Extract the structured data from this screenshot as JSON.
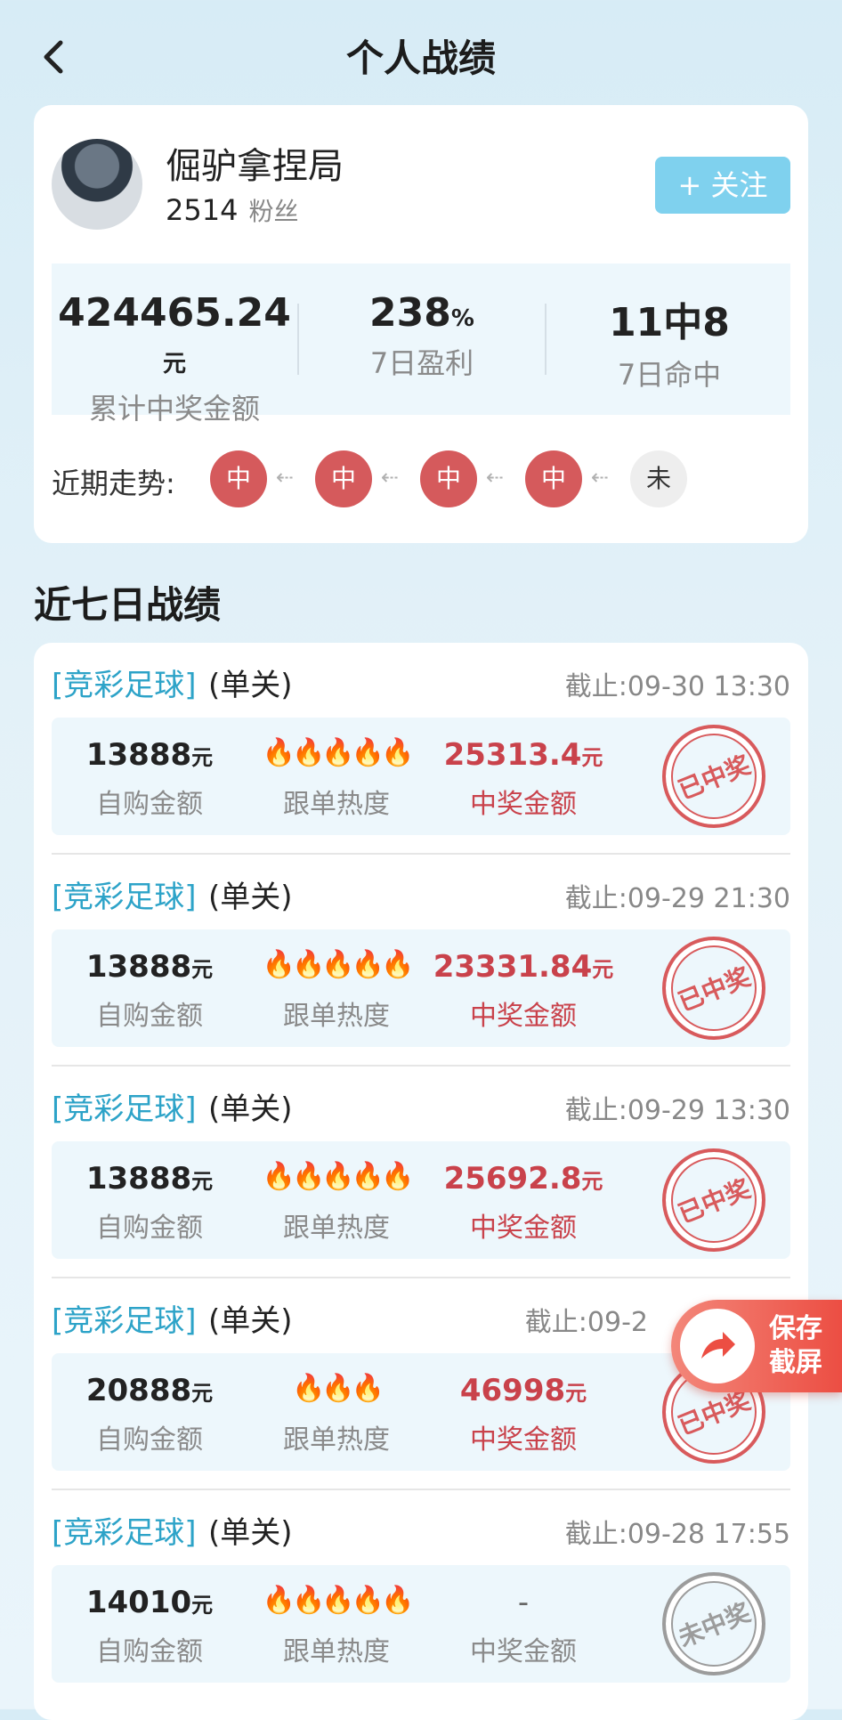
{
  "header": {
    "title": "个人战绩"
  },
  "profile": {
    "name": "倔驴拿捏局",
    "fans_count": "2514",
    "fans_label": "粉丝",
    "follow_label": "+ 关注"
  },
  "stats": [
    {
      "value": "424465.24",
      "unit": "元",
      "label": "累计中奖金额"
    },
    {
      "value": "238",
      "unit": "%",
      "label": "7日盈利"
    },
    {
      "value": "11中8",
      "unit": "",
      "label": "7日命中"
    }
  ],
  "trend": {
    "label": "近期走势:",
    "items": [
      "中",
      "中",
      "中",
      "中",
      "未"
    ],
    "arrow": "⇠"
  },
  "section_title": "近七日战绩",
  "records": [
    {
      "lottery": "[竞彩足球]",
      "type": "(单关)",
      "deadline": "截止:09-30 13:30",
      "self_amount": "13888",
      "self_unit": "元",
      "self_label": "自购金额",
      "heat": "🔥🔥🔥🔥🔥",
      "heat_level": 5,
      "heat_label": "跟单热度",
      "prize": "25313.4",
      "prize_unit": "元",
      "prize_label": "中奖金额",
      "stamp": "已中奖",
      "won": true
    },
    {
      "lottery": "[竞彩足球]",
      "type": "(单关)",
      "deadline": "截止:09-29 21:30",
      "self_amount": "13888",
      "self_unit": "元",
      "self_label": "自购金额",
      "heat": "🔥🔥🔥🔥🔥",
      "heat_level": 5,
      "heat_label": "跟单热度",
      "prize": "23331.84",
      "prize_unit": "元",
      "prize_label": "中奖金额",
      "stamp": "已中奖",
      "won": true
    },
    {
      "lottery": "[竞彩足球]",
      "type": "(单关)",
      "deadline": "截止:09-29 13:30",
      "self_amount": "13888",
      "self_unit": "元",
      "self_label": "自购金额",
      "heat": "🔥🔥🔥🔥🔥",
      "heat_level": 5,
      "heat_label": "跟单热度",
      "prize": "25692.8",
      "prize_unit": "元",
      "prize_label": "中奖金额",
      "stamp": "已中奖",
      "won": true
    },
    {
      "lottery": "[竞彩足球]",
      "type": "(单关)",
      "deadline": "截止:09-2",
      "self_amount": "20888",
      "self_unit": "元",
      "self_label": "自购金额",
      "heat": "🔥🔥🔥",
      "heat_level": 3,
      "heat_label": "跟单热度",
      "prize": "46998",
      "prize_unit": "元",
      "prize_label": "中奖金额",
      "stamp": "已中奖",
      "won": true
    },
    {
      "lottery": "[竞彩足球]",
      "type": "(单关)",
      "deadline": "截止:09-28 17:55",
      "self_amount": "14010",
      "self_unit": "元",
      "self_label": "自购金额",
      "heat": "🔥🔥🔥🔥🔥",
      "heat_level": 5,
      "heat_label": "跟单热度",
      "prize": "-",
      "prize_unit": "",
      "prize_label": "中奖金额",
      "stamp": "未中奖",
      "won": false
    }
  ],
  "save_button": {
    "label": "保存截屏"
  },
  "colors": {
    "accent": "#7fd1ee",
    "win": "#d55a5c",
    "link": "#2da3c8",
    "prize": "#c9424b"
  }
}
